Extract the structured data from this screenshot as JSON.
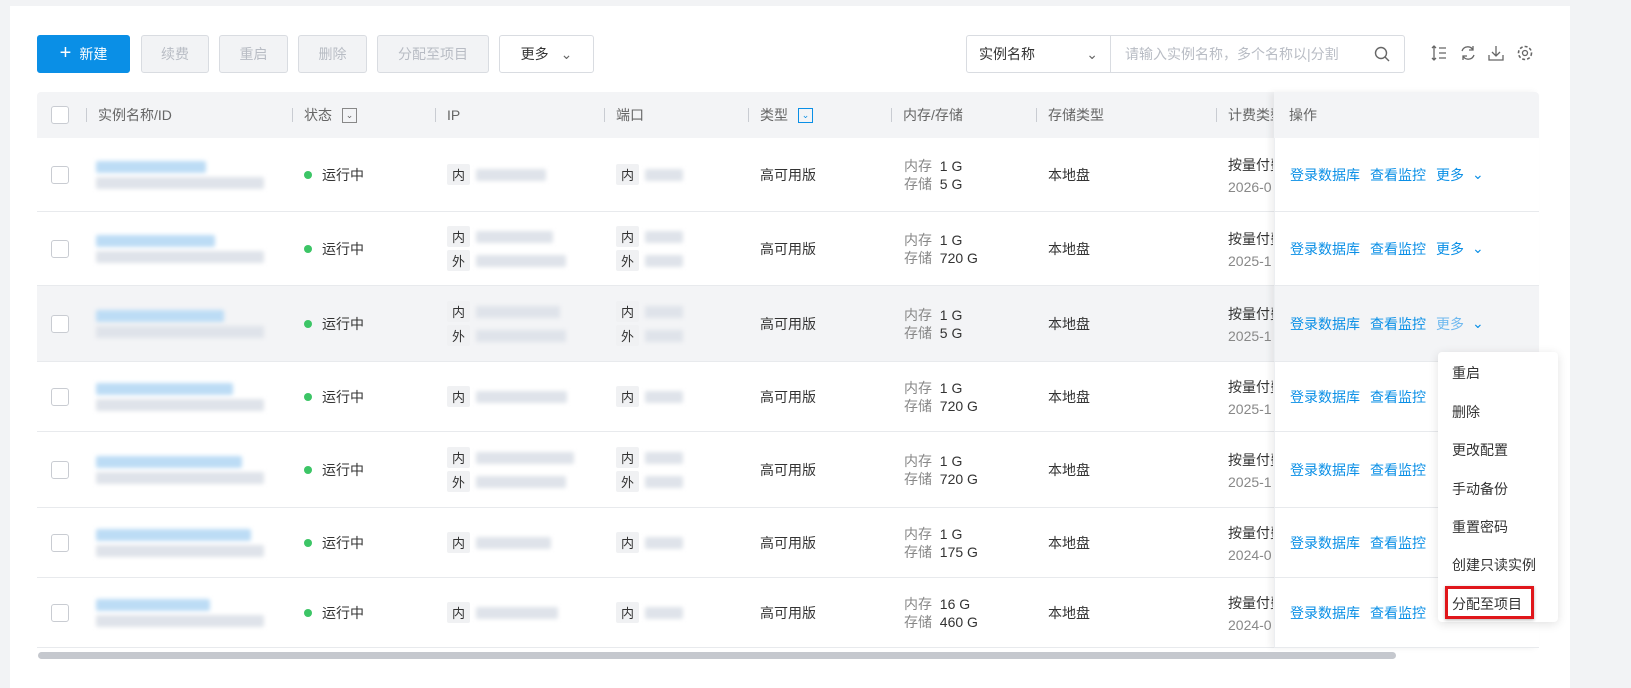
{
  "toolbar": {
    "new": "新建",
    "renew": "续费",
    "restart": "重启",
    "delete": "删除",
    "assign": "分配至项目",
    "more": "更多"
  },
  "search": {
    "field": "实例名称",
    "placeholder": "请输入实例名称，多个名称以|分割"
  },
  "icons": [
    "sort-icon",
    "refresh-icon",
    "download-icon",
    "settings-icon"
  ],
  "columns": {
    "name": "实例名称/ID",
    "status": "状态",
    "ip": "IP",
    "port": "端口",
    "type": "类型",
    "mem": "内存/存储",
    "storage_type": "存储类型",
    "billing": "计费类型",
    "ops": "操作"
  },
  "labels": {
    "inner": "内",
    "outer": "外",
    "mem": "内存",
    "disk": "存储",
    "login": "登录数据库",
    "monitor": "查看监控",
    "more": "更多"
  },
  "rows": [
    {
      "status": "运行中",
      "type": "高可用版",
      "mem": "1 G",
      "disk": "5 G",
      "storage": "本地盘",
      "billing": "按量付费",
      "date": "2026-0",
      "outer": false
    },
    {
      "status": "运行中",
      "type": "高可用版",
      "mem": "1 G",
      "disk": "720 G",
      "storage": "本地盘",
      "billing": "按量付费",
      "date": "2025-1",
      "outer": true
    },
    {
      "status": "运行中",
      "type": "高可用版",
      "mem": "1 G",
      "disk": "5 G",
      "storage": "本地盘",
      "billing": "按量付费",
      "date": "2025-1",
      "outer": true
    },
    {
      "status": "运行中",
      "type": "高可用版",
      "mem": "1 G",
      "disk": "720 G",
      "storage": "本地盘",
      "billing": "按量付费",
      "date": "2025-1",
      "outer": false
    },
    {
      "status": "运行中",
      "type": "高可用版",
      "mem": "1 G",
      "disk": "720 G",
      "storage": "本地盘",
      "billing": "按量付费",
      "date": "2025-1",
      "outer": true
    },
    {
      "status": "运行中",
      "type": "高可用版",
      "mem": "1 G",
      "disk": "175 G",
      "storage": "本地盘",
      "billing": "按量付费",
      "date": "2024-0",
      "outer": false
    },
    {
      "status": "运行中",
      "type": "高可用版",
      "mem": "16 G",
      "disk": "460 G",
      "storage": "本地盘",
      "billing": "按量付费",
      "date": "2024-0",
      "outer": false
    }
  ],
  "menu": [
    "重启",
    "删除",
    "更改配置",
    "手动备份",
    "重置密码",
    "创建只读实例",
    "分配至项目"
  ],
  "colors": {
    "accent": "#0a8fe6",
    "running": "#3cc566",
    "highlight": "#e0161b"
  }
}
